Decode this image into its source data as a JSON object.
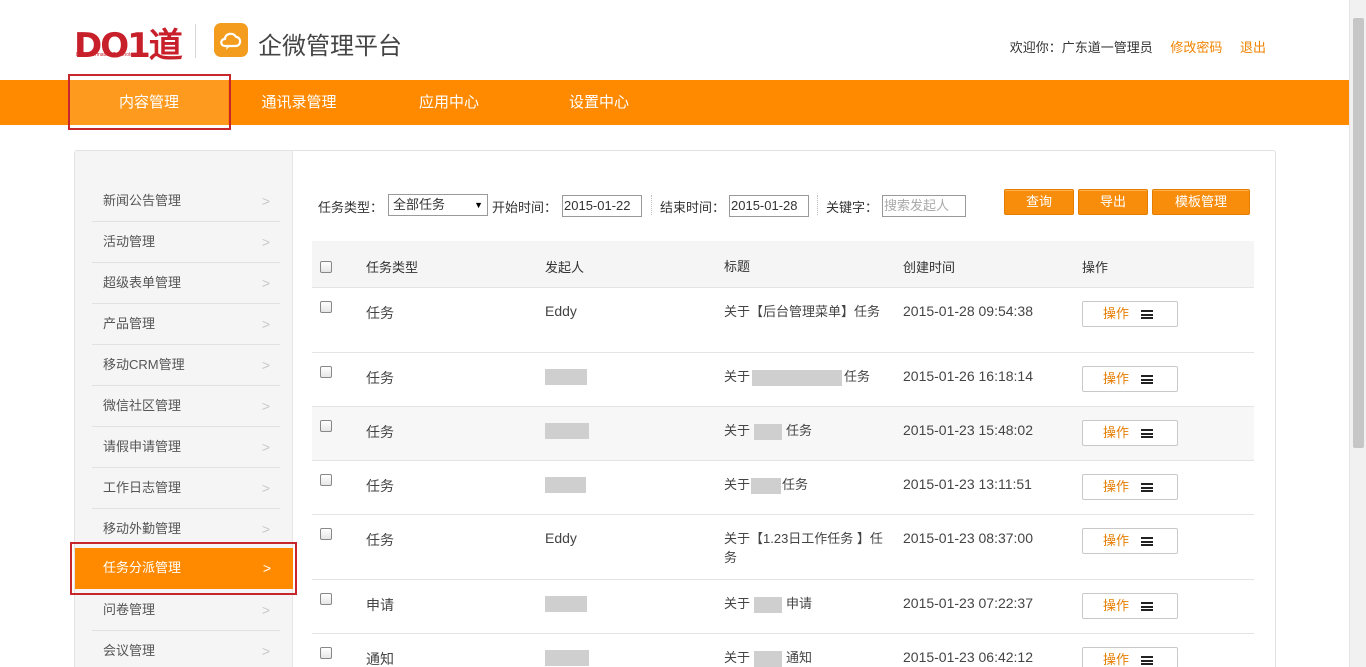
{
  "header": {
    "logo_text": "DO1道",
    "logo_sub": "Do1 Information Technology",
    "app_title": "企微管理平台",
    "welcome": "欢迎你：广东道一管理员",
    "change_password": "修改密码",
    "logout": "退出"
  },
  "nav": {
    "items": [
      "内容管理",
      "通讯录管理",
      "应用中心",
      "设置中心"
    ],
    "active": "内容管理"
  },
  "sidebar": {
    "items": [
      "新闻公告管理",
      "活动管理",
      "超级表单管理",
      "产品管理",
      "移动CRM管理",
      "微信社区管理",
      "请假申请管理",
      "工作日志管理",
      "移动外勤管理",
      "任务分派管理",
      "问卷管理",
      "会议管理"
    ],
    "active": "任务分派管理",
    "chevron": ">"
  },
  "filter": {
    "task_type_label": "任务类型：",
    "task_type_value": "全部任务",
    "start_label": "开始时间：",
    "start_value": "2015-01-22",
    "end_label": "结束时间：",
    "end_value": "2015-01-28",
    "keyword_label": "关键字：",
    "keyword_placeholder": "搜索发起人",
    "query_button": "查询",
    "export_button": "导出",
    "template_button": "模板管理"
  },
  "table": {
    "headers": [
      "任务类型",
      "发起人",
      "标题",
      "创建时间",
      "操作"
    ],
    "op_label": "操作",
    "rows": [
      {
        "type": "任务",
        "user": "Eddy",
        "title_prefix": "",
        "title_suffix": "关于【后台管理菜单】任务",
        "time": "2015-01-28 09:54:38"
      },
      {
        "type": "任务",
        "user": "",
        "title_prefix": "关于",
        "title_suffix": "任务",
        "time": "2015-01-26 16:18:14"
      },
      {
        "type": "任务",
        "user": "",
        "title_prefix": "关于",
        "title_suffix": "任务",
        "time": "2015-01-23 15:48:02"
      },
      {
        "type": "任务",
        "user": "",
        "title_prefix": "关于",
        "title_suffix": "任务",
        "time": "2015-01-23 13:11:51"
      },
      {
        "type": "任务",
        "user": "Eddy",
        "title_prefix": "",
        "title_suffix": "关于【1.23日工作任务 】任务",
        "time": "2015-01-23 08:37:00"
      },
      {
        "type": "申请",
        "user": "",
        "title_prefix": "关于",
        "title_suffix": "申请",
        "time": "2015-01-23 07:22:37"
      },
      {
        "type": "通知",
        "user": "",
        "title_prefix": "关于",
        "title_suffix": "通知",
        "time": "2015-01-23 06:42:12"
      }
    ]
  },
  "colors": {
    "brand_orange": "#ff8a00",
    "logo_red": "#c8202a",
    "highlight_red": "#c6262c"
  }
}
